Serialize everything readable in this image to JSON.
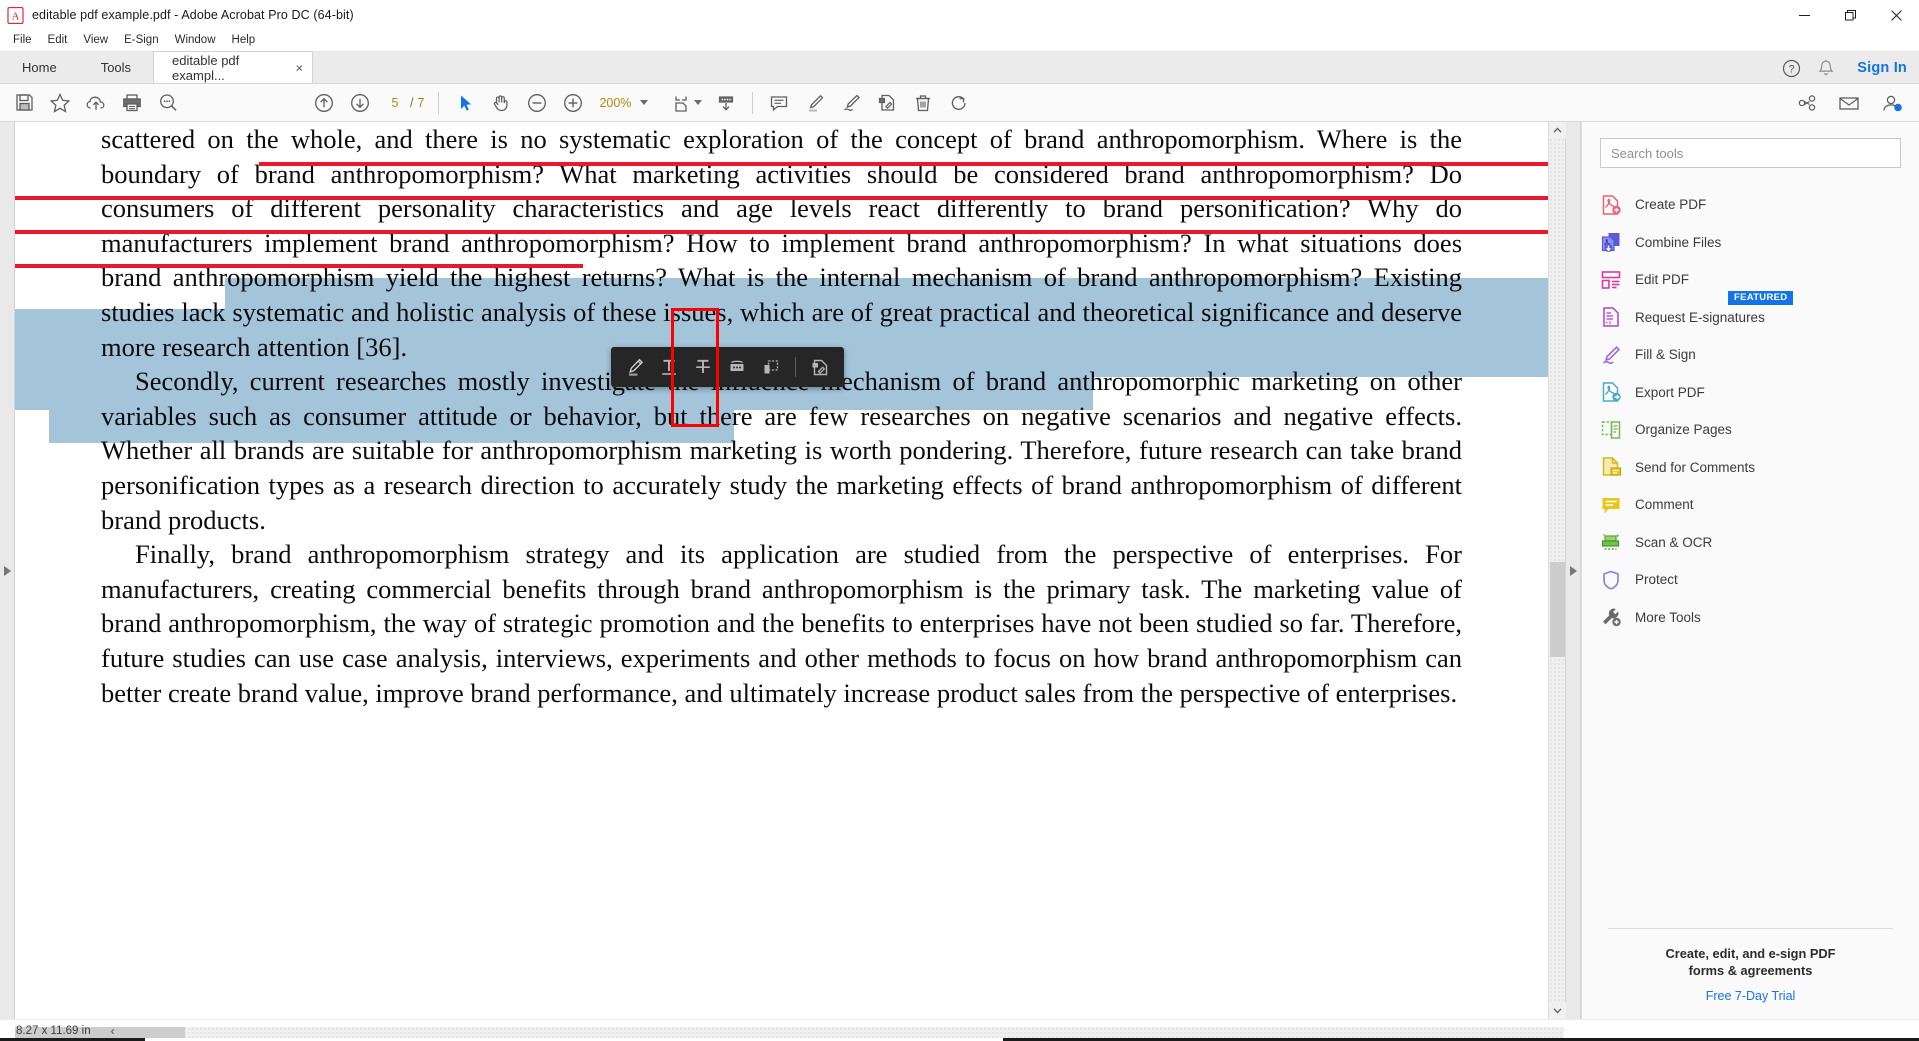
{
  "window": {
    "title": "editable pdf example.pdf - Adobe Acrobat Pro DC (64-bit)",
    "app_icon": "acrobat-icon",
    "minimize": "—",
    "maximize": "❐",
    "close": "✕"
  },
  "menubar": {
    "items": [
      "File",
      "Edit",
      "View",
      "E-Sign",
      "Window",
      "Help"
    ]
  },
  "tabbar": {
    "home": "Home",
    "tools": "Tools",
    "document_tab": "editable pdf exampl...",
    "close_tab": "×",
    "help_icon": "question-mark-icon",
    "bell_icon": "notification-bell-icon",
    "signin": "Sign In"
  },
  "toolbar": {
    "save": "save-icon",
    "star": "add-to-favorites-icon",
    "upload": "upload-to-cloud-icon",
    "print": "print-icon",
    "find": "find-icon",
    "prev_page": "previous-page-icon",
    "next_page": "next-page-icon",
    "page_current": "5",
    "page_separator": "/",
    "page_total": "7",
    "select_tool": "cursor-select-icon",
    "hand_tool": "hand-pan-icon",
    "zoom_out": "zoom-out-icon",
    "zoom_in": "zoom-in-icon",
    "zoom_level": "200%",
    "page_fit": "page-fit-icon",
    "scroll_mode": "scroll-mode-icon",
    "comment": "comment-icon",
    "highlight": "highlight-marker-icon",
    "draw": "draw-freehand-icon",
    "stamp": "stamp-icon",
    "delete": "trash-icon",
    "rotate": "rotate-clockwise-icon",
    "share_link": "share-link-icon",
    "email": "email-icon",
    "account": "account-avatar-icon"
  },
  "float_toolbar": {
    "buttons": [
      {
        "name": "highlight-text-icon",
        "label": "Highlight text"
      },
      {
        "name": "underline-text-icon",
        "label": "Underline text"
      },
      {
        "name": "strikethrough-text-icon",
        "label": "Strikethrough text"
      },
      {
        "name": "add-text-comment-icon",
        "label": "Add text comment"
      },
      {
        "name": "add-text-box-icon",
        "label": "Add text box"
      },
      {
        "name": "add-stamp-icon",
        "label": "Add stamp"
      }
    ],
    "selected_index": 2
  },
  "document": {
    "paragraphs": [
      {
        "id": "p1",
        "segments": [
          {
            "text": "scattered on the whole, and there is no systematic exploration of the concept of brand anthropomorphism. ",
            "style": "plain"
          },
          {
            "text": "Where is the boundary of brand anthropomorphism? What marketing activities should be considered brand anthropomorphism? Do consumers of different personality characteristics and age levels react differently to brand personification? Why do manufacturers implement brand anthropomorphism? How to implement brand",
            "style": "strikethrough"
          },
          {
            "text": " anthropomorphism? In what situations does brand anthropomorphism ",
            "style": "plain"
          },
          {
            "text": "yield the highest returns? What is the internal mechanism of brand anthropomorphism? Existing studies lack systematic and holistic analysis of these issues, which are of great practical and theoretical significance and deserve more research attention [36].",
            "style": "highlight"
          }
        ]
      },
      {
        "id": "p2",
        "segments": [
          {
            "text": "Secondly, current researches mostly investigate",
            "style": "highlight-indent"
          },
          {
            "text": " the influence mechanism of brand anthropomorphic marketing on other variables such as consumer attitude or behavior, but there are few researches on negative scenarios and negative effects. Whether all brands are suitable for anthropomorphism marketing is worth pondering. Therefore, future research can take brand personification types as a research direction to accurately study the marketing effects of brand anthropomorphism of different brand products.",
            "style": "plain"
          }
        ]
      },
      {
        "id": "p3",
        "segments": [
          {
            "text": "Finally, brand anthropomorphism strategy and its application are studied from the perspective of enterprises. For manufacturers, creating commercial benefits through brand anthropomorphism is the primary task. The marketing value of brand anthropomorphism, the way of strategic promotion and the benefits to enterprises have not been studied so far. Therefore, future studies can use case analysis, interviews, experiments and other methods to focus on how brand anthropomorphism can better create brand value, improve brand performance, and ultimately increase product sales from the perspective of enterprises.",
            "style": "plain-indent"
          }
        ]
      }
    ]
  },
  "tools_panel": {
    "search_placeholder": "Search tools",
    "items": [
      {
        "label": "Create PDF",
        "icon": "create-pdf-icon",
        "badge": ""
      },
      {
        "label": "Combine Files",
        "icon": "combine-files-icon",
        "badge": ""
      },
      {
        "label": "Edit PDF",
        "icon": "edit-pdf-icon",
        "badge": ""
      },
      {
        "label": "Request E-signatures",
        "icon": "request-esignatures-icon",
        "badge": "FEATURED"
      },
      {
        "label": "Fill & Sign",
        "icon": "fill-and-sign-icon",
        "badge": ""
      },
      {
        "label": "Export PDF",
        "icon": "export-pdf-icon",
        "badge": ""
      },
      {
        "label": "Organize Pages",
        "icon": "organize-pages-icon",
        "badge": ""
      },
      {
        "label": "Send for Comments",
        "icon": "send-for-comments-icon",
        "badge": ""
      },
      {
        "label": "Comment",
        "icon": "comment-tool-icon",
        "badge": ""
      },
      {
        "label": "Scan & OCR",
        "icon": "scan-and-ocr-icon",
        "badge": ""
      },
      {
        "label": "Protect",
        "icon": "protect-shield-icon",
        "badge": ""
      },
      {
        "label": "More Tools",
        "icon": "more-tools-icon",
        "badge": ""
      }
    ],
    "promo_line1": "Create, edit, and e-sign PDF",
    "promo_line2": "forms & agreements",
    "trial_link": "Free 7-Day Trial"
  },
  "statusbar": {
    "page_size": "8.27 x 11.69 in",
    "prev_view": "‹"
  },
  "colors": {
    "accent_blue": "#1473e6",
    "strike_red": "#e8192c",
    "highlight_blue": "#a4c4da",
    "focus_red": "#ff0000",
    "toolbar_bg": "#fafafa",
    "page_number": "#b8860b"
  }
}
